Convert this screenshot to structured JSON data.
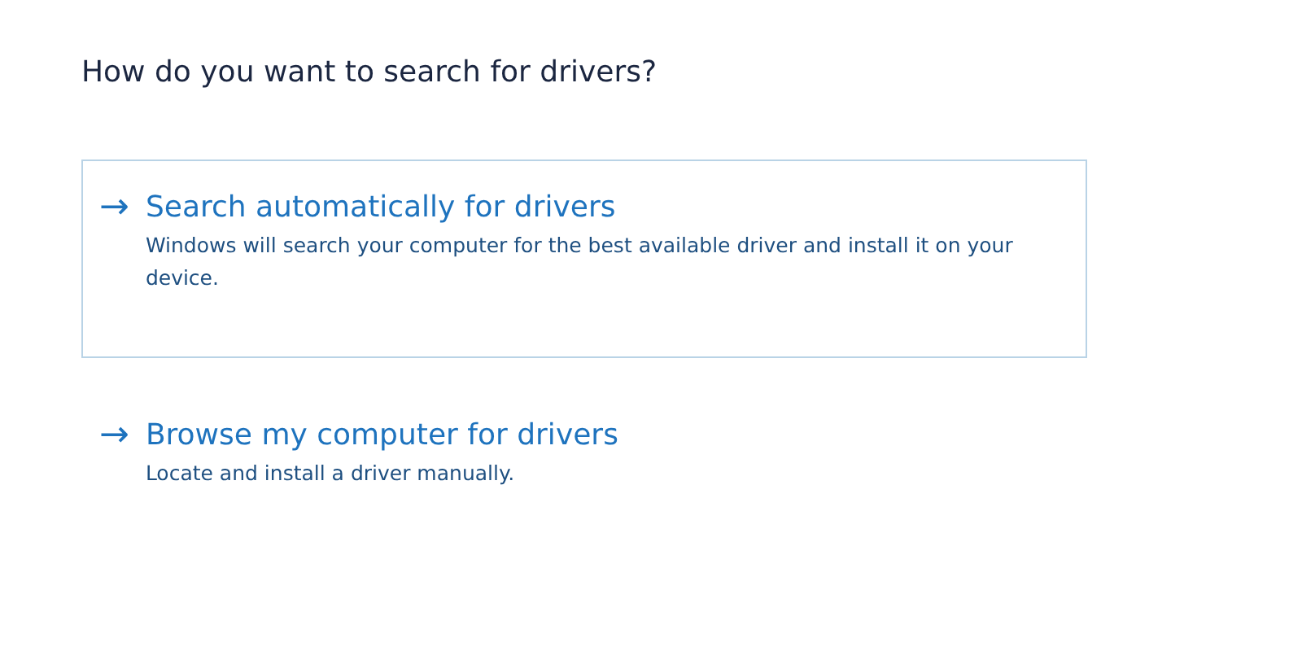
{
  "heading": "How do you want to search for drivers?",
  "options": [
    {
      "arrow": "→",
      "title": "Search automatically for drivers",
      "description": "Windows will search your computer for the best available driver and install it on your device.",
      "selected": true
    },
    {
      "arrow": "→",
      "title": "Browse my computer for drivers",
      "description": "Locate and install a driver manually.",
      "selected": false
    }
  ]
}
